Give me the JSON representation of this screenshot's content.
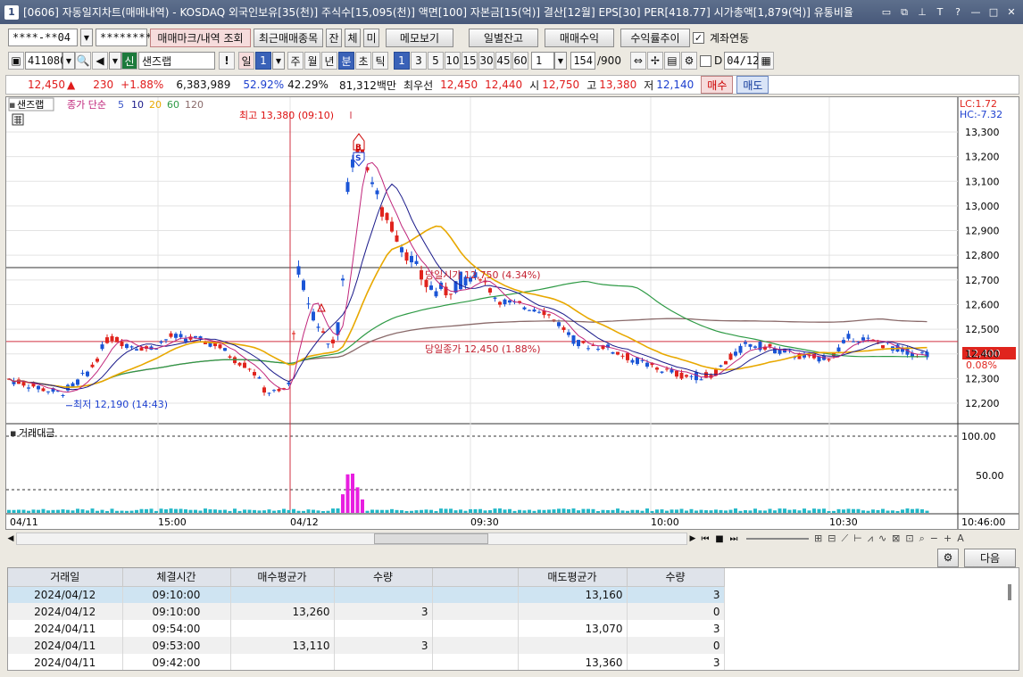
{
  "window": {
    "badge": "1",
    "title": "[0606] 자동일지차트(매매내역) - KOSDAQ 외국인보유[35(천)] 주식수[15,095(천)] 액면[100] 자본금[15(억)] 결산[12월] EPS[30] PER[418.77] 시가총액[1,879(억)] 유통비율"
  },
  "toolbar1": {
    "account": "****-**04",
    "password": "*********",
    "btn_trade_mark": "매매마크/내역 조회",
    "btn_recent": "최근매매종목",
    "btn_jan": "잔",
    "btn_che": "체",
    "btn_mi": "미",
    "btn_memo": "메모보기",
    "btn_daily": "일별잔고",
    "btn_profit": "매매수익",
    "btn_return": "수익률추이",
    "account_link_label": "계좌연동",
    "account_link_checked": true
  },
  "toolbar2": {
    "code": "411080",
    "shin": "신",
    "stock_name": "샌즈랩",
    "excl": "!",
    "period_il": "일",
    "period_num": "1",
    "tabs": [
      "주",
      "월",
      "년",
      "분",
      "초",
      "틱"
    ],
    "minute_opts": [
      "1",
      "3",
      "5",
      "10",
      "15",
      "30",
      "45",
      "60"
    ],
    "interval": "1",
    "count": "154",
    "count_total": "/900",
    "d_label": "D",
    "date": "04/12"
  },
  "pricebar": {
    "price": "12,450",
    "arrow": "▲",
    "change": "230",
    "rate": "+1.88%",
    "volume": "6,383,989",
    "ratio1": "52.92%",
    "ratio2": "42.29%",
    "amount": "81,312백만",
    "best_label": "최우선",
    "best_ask": "12,450",
    "best_bid": "12,440",
    "open_label": "시",
    "open": "12,750",
    "high_label": "고",
    "high": "13,380",
    "low_label": "저",
    "low": "12,140",
    "buy": "매수",
    "sell": "매도"
  },
  "chart": {
    "stock_tag": "샌즈랩",
    "legend_close": "종가 단순",
    "ma_periods": [
      "5",
      "10",
      "20",
      "60",
      "120"
    ],
    "ma_colors": [
      "#3a55c8",
      "#1a1a8a",
      "#e8a800",
      "#2e9a45",
      "#8a6a6a"
    ],
    "lc": "LC:1.72",
    "hc": "HC:-7.32",
    "annot_high": "최고 13,380 (09:10)",
    "annot_low": "최저 12,190 (14:43)",
    "annot_open": "당일시가 12,750 (4.34%)",
    "annot_close": "당일종가 12,450 (1.88%)",
    "current_price": "12,400",
    "current_rate": "0.08%",
    "y_labels": [
      "13,300",
      "13,200",
      "13,100",
      "13,000",
      "12,900",
      "12,800",
      "12,700",
      "12,600",
      "12,500",
      "12,400",
      "12,300",
      "12,200"
    ],
    "vol_title": "거래대금",
    "vol_labels": [
      "100.00",
      "50.00"
    ],
    "x_labels": [
      "04/11",
      "15:00",
      "04/12",
      "09:30",
      "10:00",
      "10:30",
      "10:46:00"
    ],
    "marker_buy": "B",
    "marker_sell": "S"
  },
  "table": {
    "headers": [
      "거래일",
      "체결시간",
      "매수평균가",
      "수량",
      "",
      "매도평균가",
      "수량"
    ],
    "rows": [
      [
        "2024/04/12",
        "09:10:00",
        "",
        "",
        "",
        "13,160",
        "3"
      ],
      [
        "2024/04/12",
        "09:10:00",
        "13,260",
        "3",
        "",
        "",
        "0"
      ],
      [
        "2024/04/11",
        "09:54:00",
        "",
        "",
        "",
        "13,070",
        "3"
      ],
      [
        "2024/04/11",
        "09:53:00",
        "13,110",
        "3",
        "",
        "",
        "0"
      ],
      [
        "2024/04/11",
        "09:42:00",
        "",
        "",
        "",
        "13,360",
        "3"
      ]
    ],
    "next_btn": "다음"
  }
}
